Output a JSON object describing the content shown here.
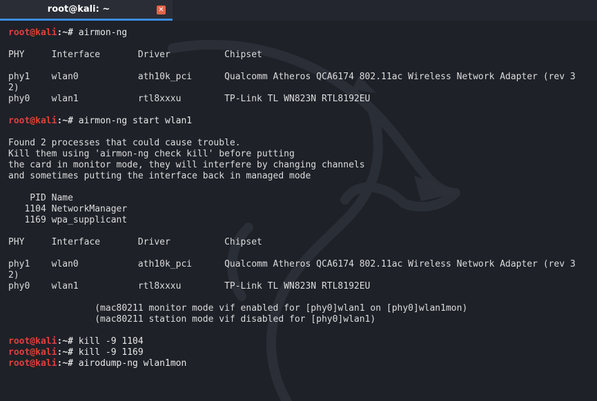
{
  "window": {
    "tab_title": "root@kali: ~",
    "close_glyph": "✕"
  },
  "prompt": {
    "user_host": "root@kali",
    "path_suffix": ":~# "
  },
  "lines": [
    {
      "type": "prompt",
      "command": "airmon-ng"
    },
    {
      "type": "blank"
    },
    {
      "type": "text",
      "text": "PHY     Interface       Driver          Chipset"
    },
    {
      "type": "blank"
    },
    {
      "type": "text",
      "text": "phy1    wlan0           ath10k_pci      Qualcomm Atheros QCA6174 802.11ac Wireless Network Adapter (rev 3"
    },
    {
      "type": "text",
      "text": "2)"
    },
    {
      "type": "text",
      "text": "phy0    wlan1           rtl8xxxu        TP-Link TL WN823N RTL8192EU"
    },
    {
      "type": "blank"
    },
    {
      "type": "prompt",
      "command": "airmon-ng start wlan1"
    },
    {
      "type": "blank"
    },
    {
      "type": "text",
      "text": "Found 2 processes that could cause trouble."
    },
    {
      "type": "text",
      "text": "Kill them using 'airmon-ng check kill' before putting"
    },
    {
      "type": "text",
      "text": "the card in monitor mode, they will interfere by changing channels"
    },
    {
      "type": "text",
      "text": "and sometimes putting the interface back in managed mode"
    },
    {
      "type": "blank"
    },
    {
      "type": "text",
      "text": "    PID Name"
    },
    {
      "type": "text",
      "text": "   1104 NetworkManager"
    },
    {
      "type": "text",
      "text": "   1169 wpa_supplicant"
    },
    {
      "type": "blank"
    },
    {
      "type": "text",
      "text": "PHY     Interface       Driver          Chipset"
    },
    {
      "type": "blank"
    },
    {
      "type": "text",
      "text": "phy1    wlan0           ath10k_pci      Qualcomm Atheros QCA6174 802.11ac Wireless Network Adapter (rev 3"
    },
    {
      "type": "text",
      "text": "2)"
    },
    {
      "type": "text",
      "text": "phy0    wlan1           rtl8xxxu        TP-Link TL WN823N RTL8192EU"
    },
    {
      "type": "blank"
    },
    {
      "type": "text",
      "text": "                (mac80211 monitor mode vif enabled for [phy0]wlan1 on [phy0]wlan1mon)"
    },
    {
      "type": "text",
      "text": "                (mac80211 station mode vif disabled for [phy0]wlan1)"
    },
    {
      "type": "blank"
    },
    {
      "type": "prompt",
      "command": "kill -9 1104"
    },
    {
      "type": "prompt",
      "command": "kill -9 1169"
    },
    {
      "type": "prompt",
      "command": "airodump-ng wlan1mon"
    }
  ],
  "colors": {
    "background": "#1e2128",
    "prompt_user": "#e0403a",
    "text": "#dcdcdc",
    "tab_accent": "#3b8ee0",
    "close_button": "#e2644a"
  }
}
